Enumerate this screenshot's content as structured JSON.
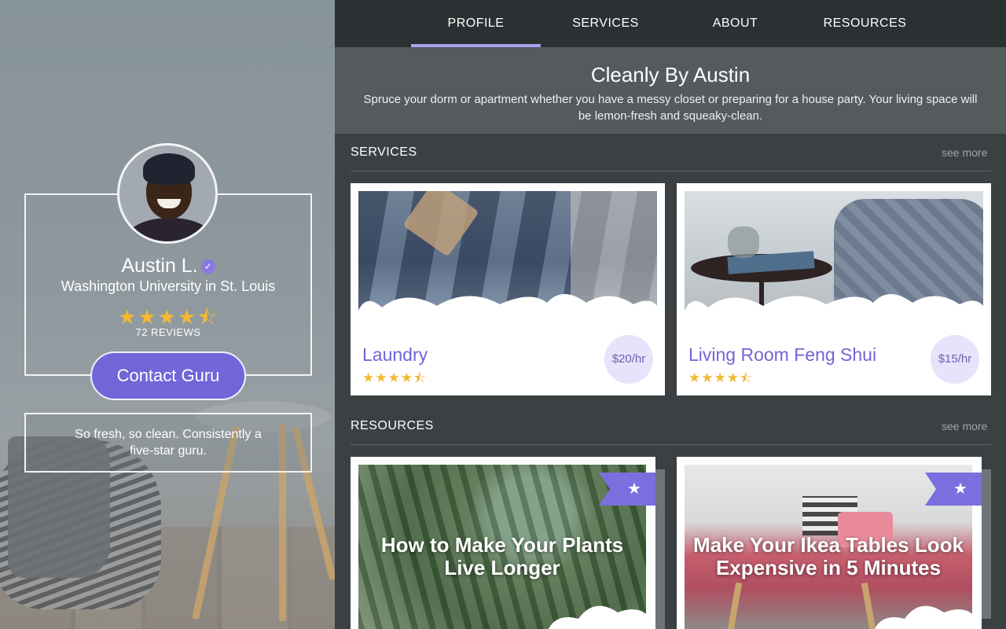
{
  "nav": {
    "tabs": [
      {
        "label": "PROFILE",
        "active": true
      },
      {
        "label": "SERVICES",
        "active": false
      },
      {
        "label": "ABOUT",
        "active": false
      },
      {
        "label": "RESOURCES",
        "active": false
      }
    ]
  },
  "hero": {
    "title": "Cleanly By Austin",
    "description": "Spruce your dorm or apartment whether you have a messy closet or preparing for a house party. Your living space will be lemon-fresh and squeaky-clean."
  },
  "profile": {
    "name": "Austin L.",
    "verified_icon": "check-badge-icon",
    "school": "Washington University in St. Louis",
    "rating": 4.5,
    "stars": "★★★★⯪",
    "reviews": "72 REVIEWS",
    "contact_label": "Contact Guru",
    "quote": "So fresh, so clean. Consistently a five-star guru."
  },
  "services": {
    "title": "SERVICES",
    "see_more": "see more",
    "items": [
      {
        "title": "Laundry",
        "rating": 4.5,
        "stars": "★★★★⯪",
        "price": "$20/hr"
      },
      {
        "title": "Living Room Feng Shui",
        "rating": 4.5,
        "stars": "★★★★⯪",
        "price": "$15/hr"
      }
    ]
  },
  "resources": {
    "title": "RESOURCES",
    "see_more": "see more",
    "items": [
      {
        "title": "How to Make Your Plants Live Longer",
        "badge_icon": "star-icon"
      },
      {
        "title": "Make Your Ikea Tables Look Expensive in 5 Minutes",
        "badge_icon": "star-icon"
      }
    ]
  },
  "colors": {
    "accent": "#7265d8",
    "star": "#f4b933",
    "nav_bg": "#2b3032",
    "panel_bg": "#3b4043"
  }
}
